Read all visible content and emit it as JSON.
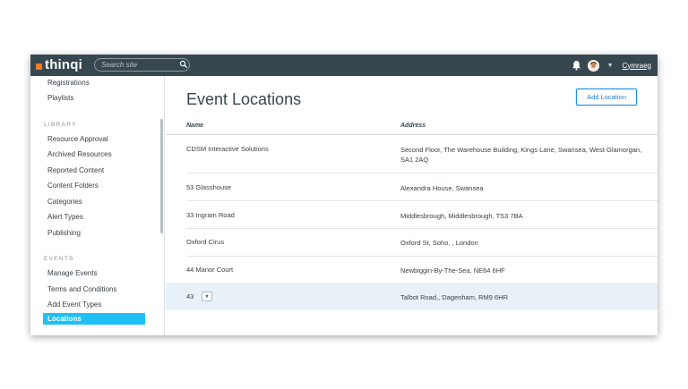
{
  "app": {
    "logo_text": "thinqi",
    "brand_color": "#f47b20"
  },
  "topbar": {
    "search_placeholder": "Search site",
    "language_link": "Cymraeg",
    "icons": [
      "search-icon",
      "bell-icon",
      "avatar",
      "chevron-down-icon"
    ]
  },
  "sidebar": {
    "top_items": [
      {
        "label": "Registrations"
      },
      {
        "label": "Playlists"
      }
    ],
    "library_heading": "LIBRARY",
    "library_items": [
      {
        "label": "Resource Approval"
      },
      {
        "label": "Archived Resources"
      },
      {
        "label": "Reported Content"
      },
      {
        "label": "Content Folders"
      },
      {
        "label": "Categories"
      },
      {
        "label": "Alert Types"
      },
      {
        "label": "Publishing"
      }
    ],
    "events_heading": "EVENTS",
    "events_items": [
      {
        "label": "Manage Events"
      },
      {
        "label": "Terms and Conditions"
      },
      {
        "label": "Add Event Types"
      },
      {
        "label": "Locations",
        "active": true
      }
    ],
    "active_color": "#1ec0f5"
  },
  "main": {
    "title": "Event Locations",
    "add_button": "Add Location",
    "columns": {
      "name": "Name",
      "address": "Address"
    },
    "rows": [
      {
        "name": "CDSM Interactive Solutions",
        "address": "Second Floor, The Warehouse Building, Kings Lane, Swansea, West Glamorgan, SA1 2AQ"
      },
      {
        "name": "53 Glasshouse",
        "address": "Alexandra House, Swansea"
      },
      {
        "name": "33 Ingram Road",
        "address": "Middlesbrough, Middlesbrough, TS3 7BA"
      },
      {
        "name": "Oxford Cirus",
        "address": "Oxford St, Soho, , London"
      },
      {
        "name": "44 Manor Court",
        "address": "Newbiggin-By-The-Sea, NE64 6HF"
      },
      {
        "name": "43",
        "address": "Talbot Road,, Dagenham, RM9 6HR",
        "highlighted": true
      }
    ]
  }
}
